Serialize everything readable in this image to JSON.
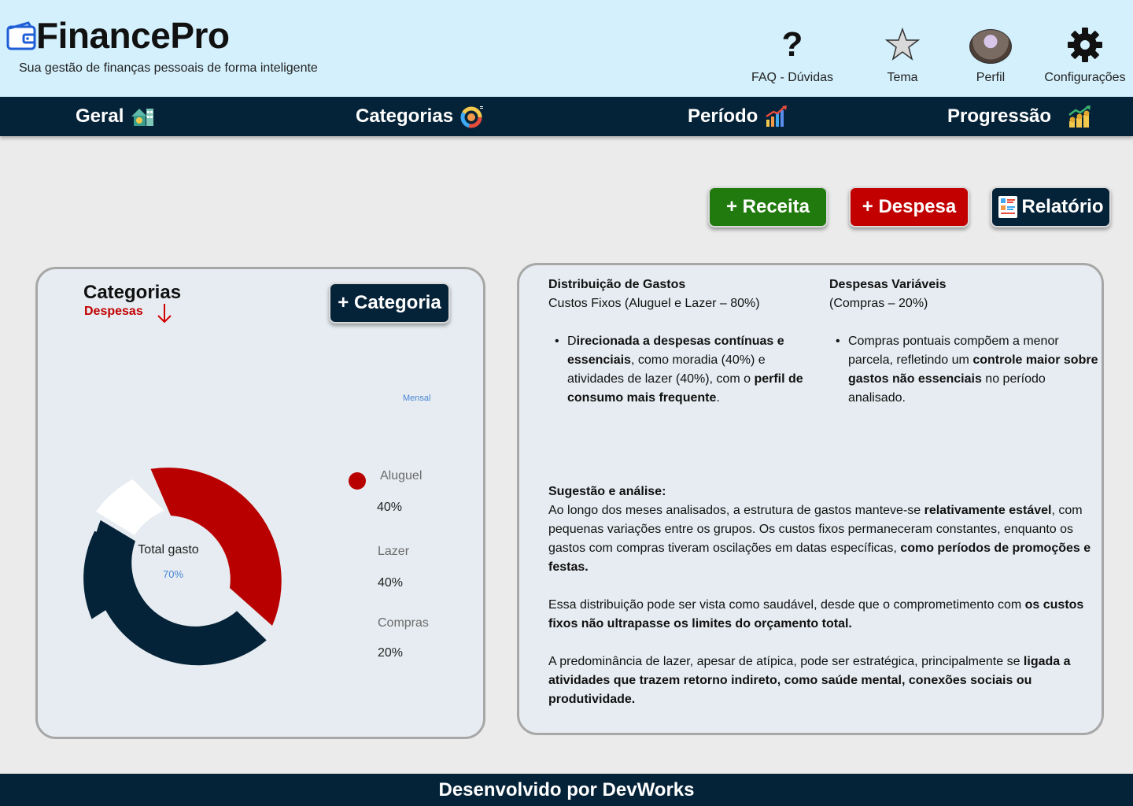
{
  "header": {
    "brand": "FinancePro",
    "tagline": "Sua gestão de finanças pessoais de forma inteligente",
    "tools": {
      "faq": "FAQ - Dúvidas",
      "tema": "Tema",
      "perfil": "Perfil",
      "config": "Configurações"
    },
    "icons": [
      "wallet-icon",
      "question-icon",
      "star-icon",
      "avatar",
      "gear-icon"
    ]
  },
  "nav": {
    "geral": "Geral",
    "categorias": "Categorias",
    "periodo": "Período",
    "progressao": "Progressão"
  },
  "actions": {
    "receita": "+ Receita",
    "despesa": "+ Despesa",
    "relatorio": "Relatório"
  },
  "categories_card": {
    "title": "Categorias",
    "subtitle": "Despesas",
    "add_button": "+ Categoria",
    "period": "Mensal",
    "center_label": "Total gasto",
    "center_value": "70%",
    "legend": [
      {
        "name": "Aluguel",
        "value": "40%"
      },
      {
        "name": "Lazer",
        "value": "40%"
      },
      {
        "name": "Compras",
        "value": "20%"
      }
    ],
    "colors": {
      "aluguel": "#b80000",
      "lazer": "#052338",
      "compras": "#ffffff"
    }
  },
  "analysis": {
    "col1_title": "Distribuição de Gastos",
    "col1_sub": "Custos Fixos (Aluguel e Lazer – 80%)",
    "col1_bullet": {
      "a": "D",
      "b": "irecionada a despesas contínuas e essenciais",
      "c": ", como moradia (40%) e atividades de lazer (40%), com o ",
      "d": "perfil de consumo mais frequente",
      "e": "."
    },
    "col2_title": "Despesas Variáveis",
    "col2_sub": "(Compras – 20%)",
    "col2_bullet": {
      "a": "Compras pontuais compõem a menor parcela, refletindo um ",
      "b": "controle maior sobre gastos não essenciais",
      "c": " no período analisado."
    },
    "sug_title": "Sugestão e análise:",
    "p1": {
      "a": "Ao longo dos meses analisados, a estrutura de gastos manteve-se ",
      "b": "relativamente estável",
      "c": ", com pequenas variações entre os grupos. Os custos fixos permaneceram constantes, enquanto os gastos com compras tiveram oscilações em datas específicas, ",
      "d": "como períodos de promoções e festas."
    },
    "p2": {
      "a": "Essa distribuição pode ser vista como saudável, desde que o comprometimento com ",
      "b": "os custos fixos não ultrapasse os limites do orçamento total."
    },
    "p3": {
      "a": "A predominância de lazer, apesar de atípica, pode ser estratégica, principalmente se ",
      "b": "ligada a atividades que trazem retorno indireto, como saúde mental, conexões sociais ou produtividade."
    }
  },
  "footer": {
    "text": "Desenvolvido por DevWorks"
  }
}
